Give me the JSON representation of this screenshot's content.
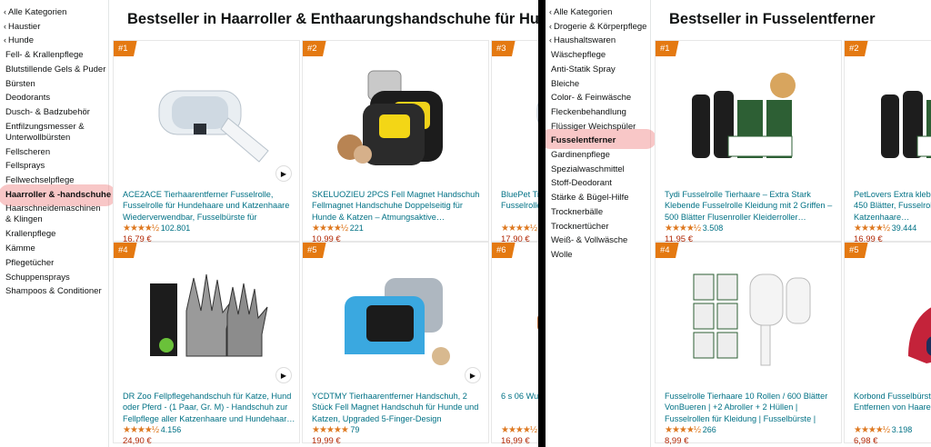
{
  "left": {
    "sidebar": [
      {
        "label": "Alle Kategorien",
        "type": "cat",
        "chevron": "‹"
      },
      {
        "label": "Haustier",
        "type": "cat",
        "chevron": "‹"
      },
      {
        "label": "Hunde",
        "type": "cat",
        "chevron": "‹"
      },
      {
        "label": "Fell- & Krallenpflege",
        "type": "sub"
      },
      {
        "label": "Blutstillende Gels & Puder",
        "type": "sub"
      },
      {
        "label": "Bürsten",
        "type": "sub"
      },
      {
        "label": "Deodorants",
        "type": "sub"
      },
      {
        "label": "Dusch- & Badzubehör",
        "type": "sub"
      },
      {
        "label": "Entfilzungsmesser & Unterwollbürsten",
        "type": "sub",
        "wrap": true
      },
      {
        "label": "Fellscheren",
        "type": "sub"
      },
      {
        "label": "Fellsprays",
        "type": "sub"
      },
      {
        "label": "Fellwechselpflege",
        "type": "sub"
      },
      {
        "label": "Haarroller & -handschuhe",
        "type": "sub",
        "active": true
      },
      {
        "label": "Haarschneidemaschinen & Klingen",
        "type": "sub",
        "wrap": true
      },
      {
        "label": "Krallenpflege",
        "type": "sub"
      },
      {
        "label": "Kämme",
        "type": "sub"
      },
      {
        "label": "Pflegetücher",
        "type": "sub"
      },
      {
        "label": "Schuppensprays",
        "type": "sub"
      },
      {
        "label": "Shampoos & Conditioner",
        "type": "sub"
      }
    ],
    "title": "Bestseller in Haarroller & Enthaarungshandschuhe für Hunde",
    "products": [
      {
        "rank": "#1",
        "title": "ACE2ACE Tierhaarentferner Fusselrolle, Fusselrolle für Hundehaare und Katzenhaare Wiederverwendbar, Fusselbürste für Tierhaar…",
        "stars": "★★★★½",
        "reviews": "102.801",
        "price": "16,79 €",
        "play": true,
        "image": "roller-icon"
      },
      {
        "rank": "#2",
        "title": "SKELUOZIEU 2PCS Fell Magnet Handschuh Fellmagnet Handschuhe Doppelseitig für Hunde & Katzen – Atmungsaktive…",
        "stars": "★★★★½",
        "reviews": "221",
        "price": "10,99 €",
        "play": false,
        "image": "glove-pair-icon"
      },
      {
        "rank": "#3",
        "title": "BluePet Tierhaarentferner Wiederverwendbar, Fusselrolle für Tierhaare, …",
        "stars": "★★★★½",
        "reviews": "",
        "price": "17,90 €",
        "play": false,
        "image": "roller-icon"
      },
      {
        "rank": "#4",
        "title": "DR Zoo Fellpflegehandschuh für Katze, Hund oder Pferd - (1 Paar, Gr. M) - Handschuh zur Fellpflege aller Katzenhaare und Hundehaar…",
        "stars": "★★★★½",
        "reviews": "4.156",
        "price": "24,90 €",
        "play": true,
        "image": "grooming-glove-icon"
      },
      {
        "rank": "#5",
        "title": "YCDTMY Tierhaarentferner Handschuh, 2 Stück Fell Magnet Handschuh für Hunde und Katzen, Upgraded 5-Finger-Design Tierhaarentferner…",
        "stars": "★★★★★",
        "reviews": "79",
        "price": "19,99 €",
        "play": true,
        "image": "blue-mitt-icon"
      },
      {
        "rank": "#6",
        "title": "6 s 06 Wunderbürste…",
        "stars": "★★★★½",
        "reviews": "",
        "price": "16,99 €",
        "play": false,
        "image": "brush-icon"
      }
    ]
  },
  "right": {
    "sidebar": [
      {
        "label": "Alle Kategorien",
        "type": "cat",
        "chevron": "‹"
      },
      {
        "label": "Drogerie & Körperpflege",
        "type": "cat",
        "chevron": "‹"
      },
      {
        "label": "Haushaltswaren",
        "type": "cat",
        "chevron": "‹"
      },
      {
        "label": "Wäschepflege",
        "type": "sub"
      },
      {
        "label": "Anti-Statik Spray",
        "type": "sub"
      },
      {
        "label": "Bleiche",
        "type": "sub"
      },
      {
        "label": "Color- & Feinwäsche",
        "type": "sub"
      },
      {
        "label": "Fleckenbehandlung",
        "type": "sub"
      },
      {
        "label": "Flüssiger Weichspüler",
        "type": "sub"
      },
      {
        "label": "Fusselentferner",
        "type": "sub",
        "active": true
      },
      {
        "label": "Gardinenpflege",
        "type": "sub"
      },
      {
        "label": "Spezialwaschmittel",
        "type": "sub"
      },
      {
        "label": "Stoff-Deodorant",
        "type": "sub"
      },
      {
        "label": "Stärke & Bügel-Hilfe",
        "type": "sub"
      },
      {
        "label": "Trocknerbälle",
        "type": "sub"
      },
      {
        "label": "Trocknertücher",
        "type": "sub"
      },
      {
        "label": "Weiß- & Vollwäsche",
        "type": "sub"
      },
      {
        "label": "Wolle",
        "type": "sub"
      }
    ],
    "title": "Bestseller in Fusselentferner",
    "products": [
      {
        "rank": "#1",
        "title": "Tydi Fusselrolle Tierhaare – Extra Stark Klebende Fusselrolle Kleidung mit 2 Griffen – 500 Blätter Flusenroller Kleiderroller…",
        "stars": "★★★★½",
        "reviews": "3.508",
        "price": "11,95 €",
        "play": false,
        "image": "lint-roller-pack-icon"
      },
      {
        "rank": "#2",
        "title": "PetLovers Extra klebrige Fusselrolle Value Set 450 Blätter, Fusselrolle für Hunde- und Katzenhaare…",
        "stars": "★★★★½",
        "reviews": "39.444",
        "price": "16,99 €",
        "play": false,
        "image": "lint-roller-pack-icon"
      },
      {
        "rank": "#4",
        "title": "Fusselrolle Tierhaare 10 Rollen / 600 Blätter VonBueren | +2 Abroller + 2 Hüllen | Fusselrollen für Kleidung | Fusselbürste | Lint…",
        "stars": "★★★★½",
        "reviews": "266",
        "price": "8,99 €",
        "play": false,
        "image": "roller-refill-icon"
      },
      {
        "rank": "#5",
        "title": "Korbond Fusselbürste Veloursbürste zum Entfernen von Haaren - Entfernt Tierhaare…",
        "stars": "★★★★½",
        "reviews": "3.198",
        "price": "6,98 €",
        "play": false,
        "image": "lint-brush-icon"
      }
    ]
  }
}
